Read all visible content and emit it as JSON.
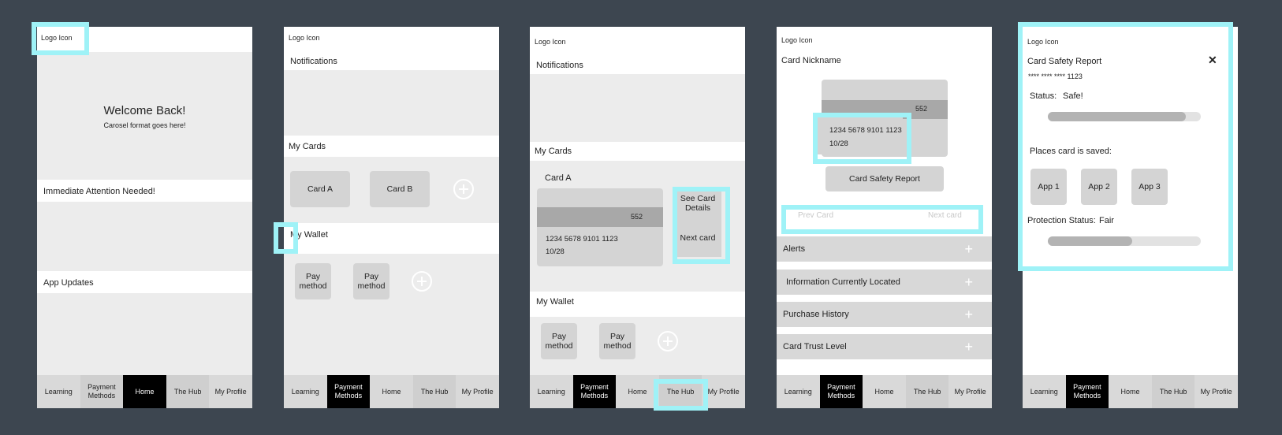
{
  "nav": {
    "items": [
      "Learning",
      "Payment Methods",
      "Home",
      "The Hub",
      "My Profile"
    ]
  },
  "s1": {
    "logo": "Logo Icon",
    "welcome": "Welcome Back!",
    "carousel": "Carosel format goes here!",
    "attention": "Immediate Attention Needed!",
    "updates": "App Updates",
    "active_nav": "Home"
  },
  "s2": {
    "logo": "Logo Icon",
    "notifications": "Notifications",
    "my_cards": "My Cards",
    "card_a": "Card A",
    "card_b": "Card B",
    "my_wallet": "My Wallet",
    "pay1": "Pay method",
    "pay2": "Pay method",
    "active_nav": "Payment Methods"
  },
  "s3": {
    "logo": "Logo Icon",
    "notifications": "Notifications",
    "my_cards": "My Cards",
    "card_a": "Card A",
    "cvv": "552",
    "card_number": "1234 5678 9101 1123",
    "expiry": "10/28",
    "see_details": "See Card Details",
    "next_card": "Next card",
    "my_wallet": "My Wallet",
    "pay1": "Pay method",
    "pay2": "Pay method",
    "active_nav": "Payment Methods"
  },
  "s4": {
    "logo": "Logo Icon",
    "nickname": "Card Nickname",
    "cvv": "552",
    "card_number": "1234 5678 9101 1123",
    "expiry": "10/28",
    "safety_report": "Card Safety Report",
    "prev_card": "Prev Card",
    "next_card": "Next card",
    "accordion": [
      "Alerts",
      "Information Currently Located",
      "Purchase History",
      "Card Trust Level"
    ],
    "active_nav": "Payment Methods"
  },
  "s5": {
    "logo": "Logo Icon",
    "title": "Card Safety Report",
    "masked": "**** **** **** 1123",
    "status_label": "Status:",
    "status_value": "Safe!",
    "status_progress": 0.9,
    "places_label": "Places card is saved:",
    "apps": [
      "App 1",
      "App 2",
      "App 3"
    ],
    "protection_label": "Protection Status:",
    "protection_value": "Fair",
    "protection_progress": 0.55,
    "close_icon": "✕",
    "active_nav": "Payment Methods"
  },
  "colors": {
    "highlight": "#9ff2f7",
    "background": "#3d4650",
    "nav_active": "#000000"
  }
}
